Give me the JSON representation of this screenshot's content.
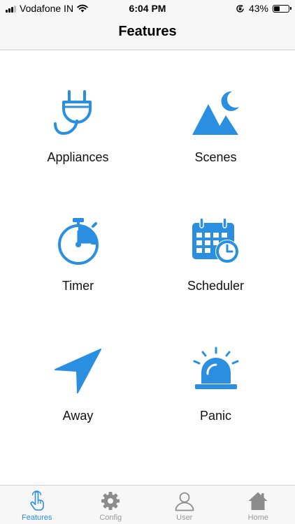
{
  "status_bar": {
    "carrier": "Vodafone IN",
    "time": "6:04 PM",
    "battery_percent_label": "43%",
    "battery_level": 0.43
  },
  "nav": {
    "title": "Features"
  },
  "features": [
    {
      "label": "Appliances",
      "icon": "plug-icon"
    },
    {
      "label": "Scenes",
      "icon": "mountain-moon-icon"
    },
    {
      "label": "Timer",
      "icon": "stopwatch-icon"
    },
    {
      "label": "Scheduler",
      "icon": "calendar-clock-icon"
    },
    {
      "label": "Away",
      "icon": "location-arrow-icon"
    },
    {
      "label": "Panic",
      "icon": "siren-icon"
    }
  ],
  "tabs": [
    {
      "label": "Features",
      "icon": "hand-pointer-icon",
      "active": true
    },
    {
      "label": "Config",
      "icon": "gear-icon",
      "active": false
    },
    {
      "label": "User",
      "icon": "user-icon",
      "active": false
    },
    {
      "label": "Home",
      "icon": "home-icon",
      "active": false
    }
  ],
  "colors": {
    "accent": "#2a8fe0",
    "tab_inactive": "#9a9a9a",
    "bar_background": "#f7f7f7"
  }
}
